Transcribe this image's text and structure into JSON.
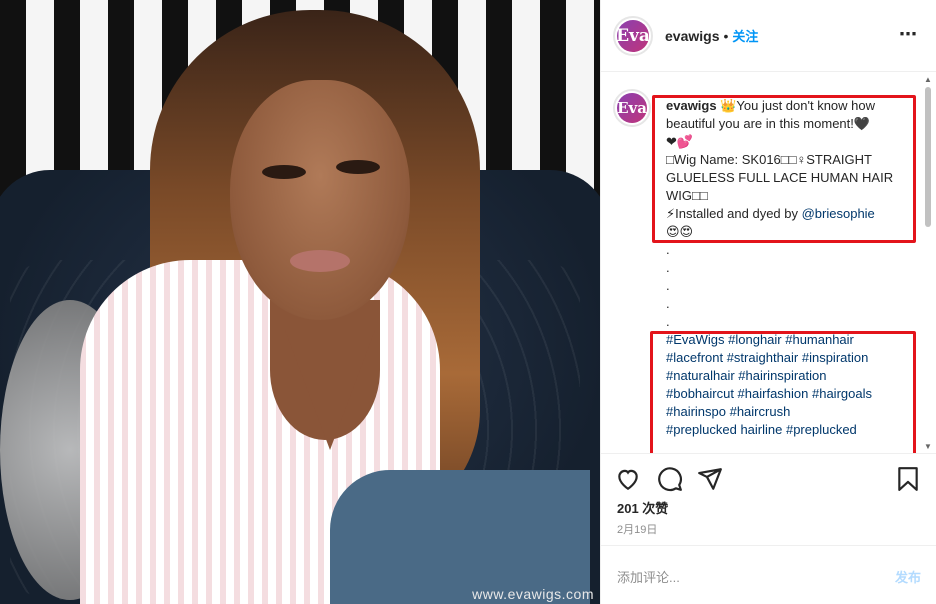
{
  "photo": {
    "watermark": "www.evawigs.com"
  },
  "header": {
    "avatar_text": "Eva",
    "username": "evawigs",
    "separator": "•",
    "follow_label": "关注",
    "more_icon": "⋯"
  },
  "caption": {
    "avatar_text": "Eva",
    "username": "evawigs",
    "line1": "👑You just don't know how beautiful you are in this moment!🖤",
    "line2": "❤💕",
    "line3": "□Wig Name: SK016□□♀STRAIGHT GLUELESS FULL LACE HUMAN HAIR WIG□□",
    "line4_prefix": "⚡Installed and dyed by ",
    "mention": "@briesophie",
    "line5": "😍😍",
    "dots": [
      ".",
      ".",
      ".",
      ".",
      "."
    ],
    "hashtags_line1": "#EvaWigs #longhair #humanhair",
    "hashtags_line2": "#lacefront #straighthair #inspiration",
    "hashtags_line3": "#naturalhair #hairinspiration",
    "hashtags_line4": "#bobhaircut #hairfashion #hairgoals",
    "hashtags_line5": "#hairinspo #haircrush",
    "hashtags_line6": "#preplucked hairline #preplucked"
  },
  "actions": {
    "like_icon": "heart-icon",
    "comment_icon": "comment-icon",
    "share_icon": "share-icon",
    "save_icon": "bookmark-icon"
  },
  "likes": "201 次赞",
  "date": "2月19日",
  "comment_box": {
    "placeholder": "添加评论...",
    "post_label": "发布"
  },
  "colors": {
    "link": "#00376b",
    "follow": "#0095f6",
    "highlight_box": "#e3141b"
  }
}
